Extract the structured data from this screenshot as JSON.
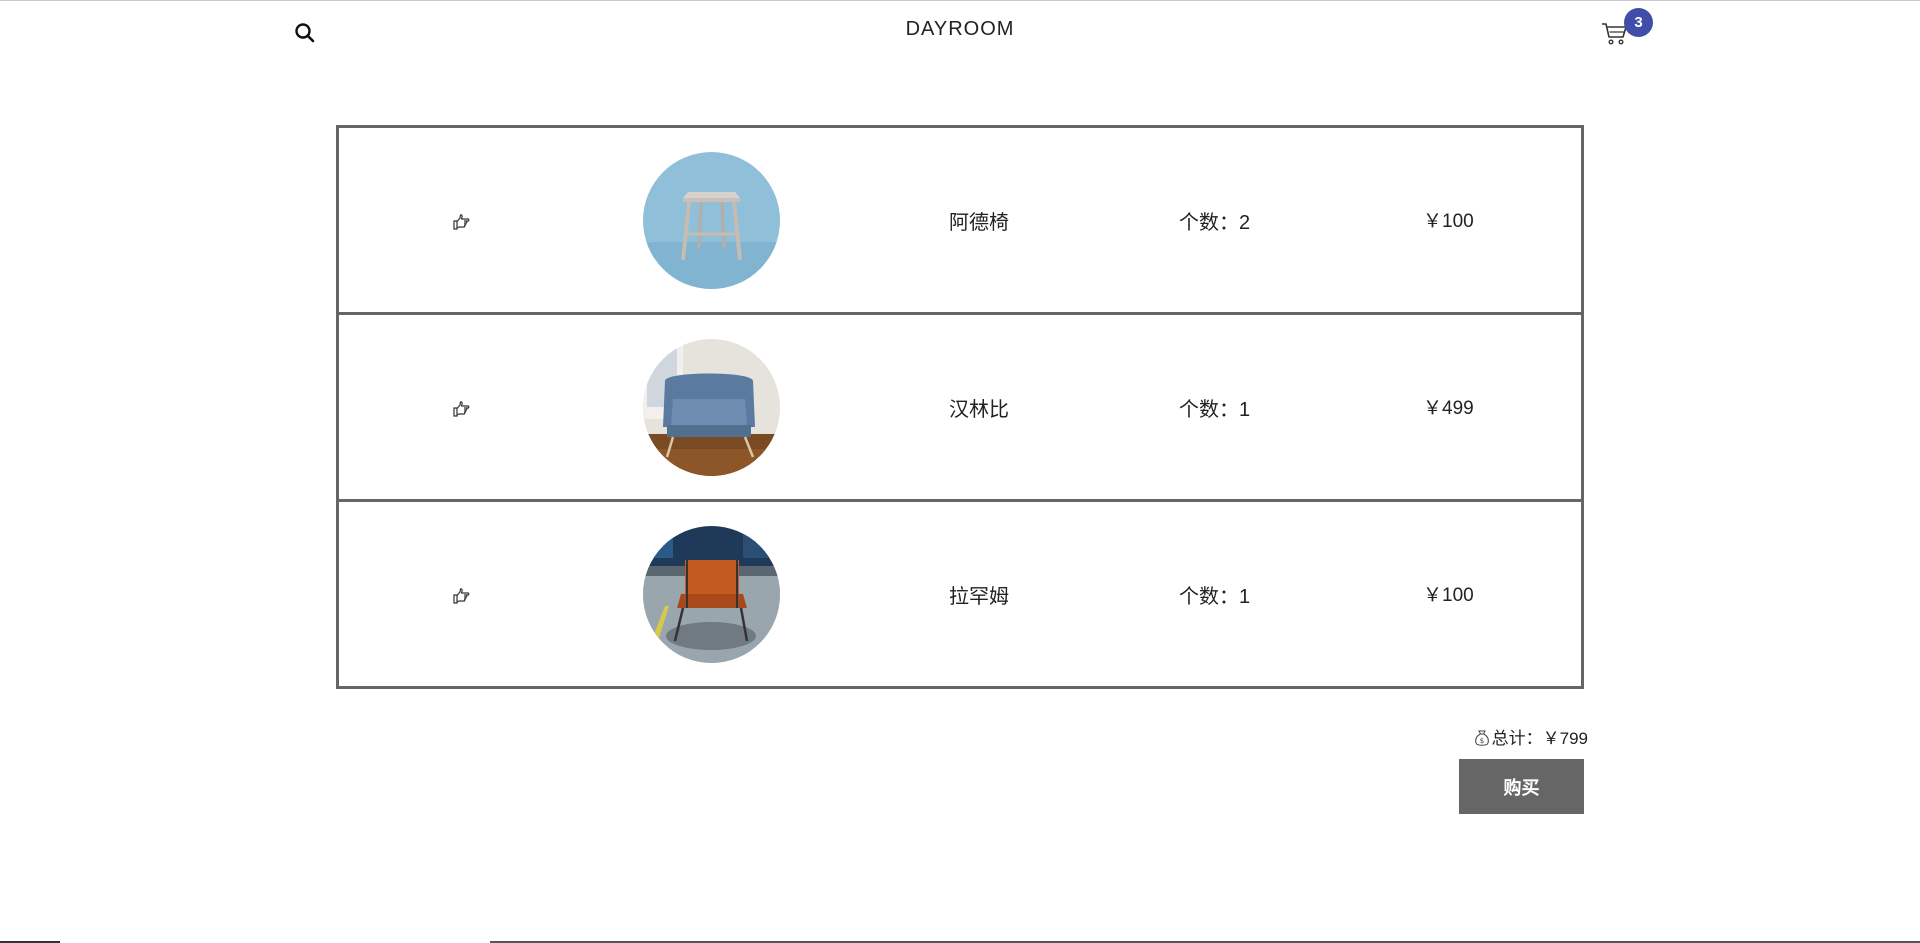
{
  "header": {
    "brand": "DAYROOM",
    "search_icon": "search-icon",
    "cart_icon": "cart-icon",
    "cart_count": "3",
    "badge_color": "#3f4ea8"
  },
  "cart": {
    "items": [
      {
        "icon": "pointing-hand-icon",
        "name": "阿德椅",
        "qty": "个数：2",
        "price": "￥100"
      },
      {
        "icon": "pointing-hand-icon",
        "name": "汉林比",
        "qty": "个数：1",
        "price": "￥499"
      },
      {
        "icon": "pointing-hand-icon",
        "name": "拉罕姆",
        "qty": "个数：1",
        "price": "￥100"
      }
    ]
  },
  "summary": {
    "money_icon": "money-bag-icon",
    "total_label": "总计：",
    "total_value": "￥799",
    "buy_label": "购买",
    "buy_button_color": "#666666"
  }
}
